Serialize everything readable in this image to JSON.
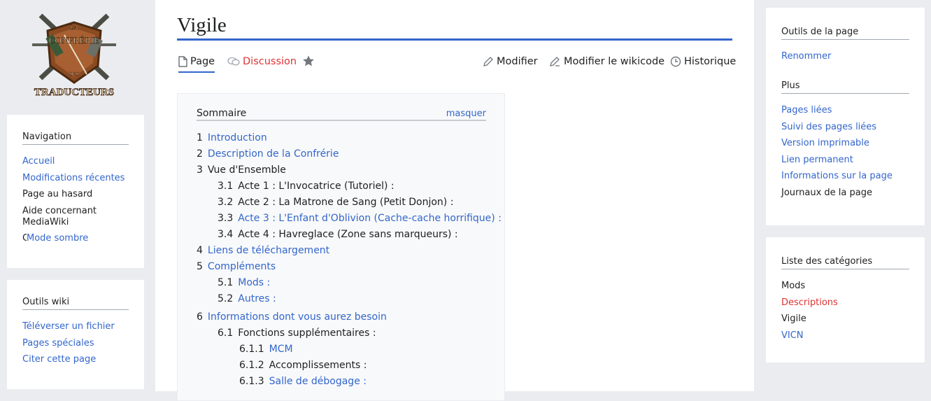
{
  "logo": {
    "line1": "LA",
    "line2": "CONFRÉRIE",
    "line3": "DES",
    "line4": "TRADUCTEURS"
  },
  "nav": {
    "title": "Navigation",
    "items": [
      {
        "label": "Accueil"
      },
      {
        "label": "Modifications récentes"
      },
      {
        "label": "Page au hasard"
      },
      {
        "label": "Aide concernant MediaWiki"
      },
      {
        "label": "Mode sombre"
      }
    ]
  },
  "tools": {
    "title": "Outils wiki",
    "items": [
      {
        "label": "Téléverser un fichier"
      },
      {
        "label": "Pages spéciales"
      },
      {
        "label": "Citer cette page"
      }
    ]
  },
  "page": {
    "title": "Vigile",
    "tabs": {
      "page": "Page",
      "discussion": "Discussion",
      "edit": "Modifier",
      "edit_source": "Modifier le wikicode",
      "history": "Historique"
    }
  },
  "toc": {
    "title": "Sommaire",
    "hide": "masquer",
    "entries": [
      {
        "num": "1",
        "text": "Introduction"
      },
      {
        "num": "2",
        "text": "Description de la Confrérie"
      },
      {
        "num": "3",
        "text": "Vue d'Ensemble"
      },
      {
        "num": "3.1",
        "text": "Acte 1 : L'Invocatrice (Tutoriel) :"
      },
      {
        "num": "3.2",
        "text": "Acte 2 : La Matrone de Sang (Petit Donjon) :"
      },
      {
        "num": "3.3",
        "text": "Acte 3 : L'Enfant d'Oblivion (Cache-cache horrifique) :"
      },
      {
        "num": "3.4",
        "text": "Acte 4 : Havreglace (Zone sans marqueurs) :"
      },
      {
        "num": "4",
        "text": "Liens de téléchargement"
      },
      {
        "num": "5",
        "text": "Compléments"
      },
      {
        "num": "5.1",
        "text": "Mods :"
      },
      {
        "num": "5.2",
        "text": "Autres :"
      },
      {
        "num": "6",
        "text": "Informations dont vous aurez besoin"
      },
      {
        "num": "6.1",
        "text": "Fonctions supplémentaires :"
      },
      {
        "num": "6.1.1",
        "text": "MCM"
      },
      {
        "num": "6.1.2",
        "text": "Accomplissements :"
      },
      {
        "num": "6.1.3",
        "text": "Salle de débogage :"
      }
    ]
  },
  "page_tools": {
    "title": "Outils de la page",
    "items": [
      {
        "label": "Renommer"
      }
    ]
  },
  "plus": {
    "title": "Plus",
    "items": [
      {
        "label": "Pages liées"
      },
      {
        "label": "Suivi des pages liées"
      },
      {
        "label": "Version imprimable"
      },
      {
        "label": "Lien permanent"
      },
      {
        "label": "Informations sur la page"
      },
      {
        "label": "Journaux de la page"
      }
    ]
  },
  "categories": {
    "title": "Liste des catégories",
    "items": [
      {
        "label": "Mods"
      },
      {
        "label": "Descriptions"
      },
      {
        "label": "Vigile"
      },
      {
        "label": "VICN"
      }
    ]
  },
  "colors": {
    "link": "#3366cc",
    "redlink": "#d33",
    "text": "#202122",
    "accent": "#3366cc"
  }
}
